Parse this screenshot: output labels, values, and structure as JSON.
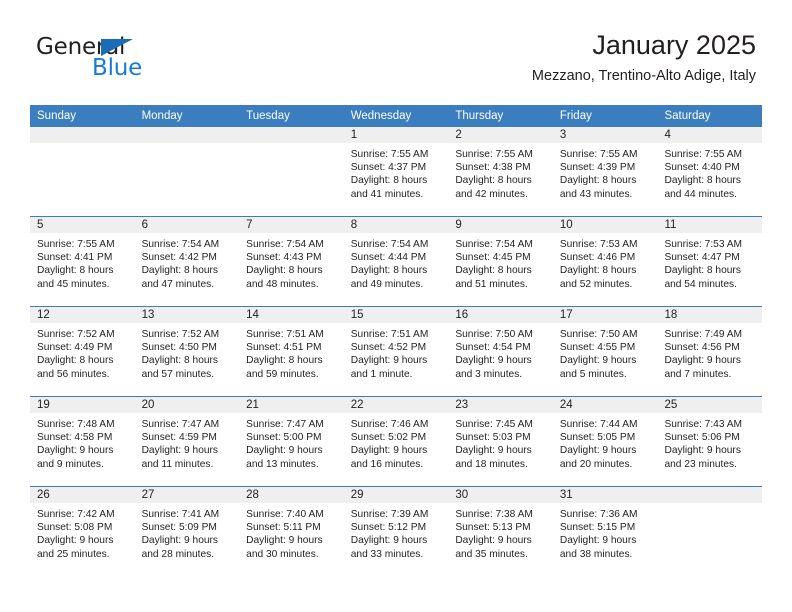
{
  "brand": {
    "name_part1": "General",
    "name_part2": "Blue",
    "accent_color": "#1a7bd4",
    "header_color": "#3a7ebf"
  },
  "header": {
    "title": "January 2025",
    "subtitle": "Mezzano, Trentino-Alto Adige, Italy"
  },
  "weekdays": [
    "Sunday",
    "Monday",
    "Tuesday",
    "Wednesday",
    "Thursday",
    "Friday",
    "Saturday"
  ],
  "weeks": [
    [
      {
        "day": "",
        "sunrise": "",
        "sunset": "",
        "daylight_line1": "",
        "daylight_line2": ""
      },
      {
        "day": "",
        "sunrise": "",
        "sunset": "",
        "daylight_line1": "",
        "daylight_line2": ""
      },
      {
        "day": "",
        "sunrise": "",
        "sunset": "",
        "daylight_line1": "",
        "daylight_line2": ""
      },
      {
        "day": "1",
        "sunrise": "Sunrise: 7:55 AM",
        "sunset": "Sunset: 4:37 PM",
        "daylight_line1": "Daylight: 8 hours",
        "daylight_line2": "and 41 minutes."
      },
      {
        "day": "2",
        "sunrise": "Sunrise: 7:55 AM",
        "sunset": "Sunset: 4:38 PM",
        "daylight_line1": "Daylight: 8 hours",
        "daylight_line2": "and 42 minutes."
      },
      {
        "day": "3",
        "sunrise": "Sunrise: 7:55 AM",
        "sunset": "Sunset: 4:39 PM",
        "daylight_line1": "Daylight: 8 hours",
        "daylight_line2": "and 43 minutes."
      },
      {
        "day": "4",
        "sunrise": "Sunrise: 7:55 AM",
        "sunset": "Sunset: 4:40 PM",
        "daylight_line1": "Daylight: 8 hours",
        "daylight_line2": "and 44 minutes."
      }
    ],
    [
      {
        "day": "5",
        "sunrise": "Sunrise: 7:55 AM",
        "sunset": "Sunset: 4:41 PM",
        "daylight_line1": "Daylight: 8 hours",
        "daylight_line2": "and 45 minutes."
      },
      {
        "day": "6",
        "sunrise": "Sunrise: 7:54 AM",
        "sunset": "Sunset: 4:42 PM",
        "daylight_line1": "Daylight: 8 hours",
        "daylight_line2": "and 47 minutes."
      },
      {
        "day": "7",
        "sunrise": "Sunrise: 7:54 AM",
        "sunset": "Sunset: 4:43 PM",
        "daylight_line1": "Daylight: 8 hours",
        "daylight_line2": "and 48 minutes."
      },
      {
        "day": "8",
        "sunrise": "Sunrise: 7:54 AM",
        "sunset": "Sunset: 4:44 PM",
        "daylight_line1": "Daylight: 8 hours",
        "daylight_line2": "and 49 minutes."
      },
      {
        "day": "9",
        "sunrise": "Sunrise: 7:54 AM",
        "sunset": "Sunset: 4:45 PM",
        "daylight_line1": "Daylight: 8 hours",
        "daylight_line2": "and 51 minutes."
      },
      {
        "day": "10",
        "sunrise": "Sunrise: 7:53 AM",
        "sunset": "Sunset: 4:46 PM",
        "daylight_line1": "Daylight: 8 hours",
        "daylight_line2": "and 52 minutes."
      },
      {
        "day": "11",
        "sunrise": "Sunrise: 7:53 AM",
        "sunset": "Sunset: 4:47 PM",
        "daylight_line1": "Daylight: 8 hours",
        "daylight_line2": "and 54 minutes."
      }
    ],
    [
      {
        "day": "12",
        "sunrise": "Sunrise: 7:52 AM",
        "sunset": "Sunset: 4:49 PM",
        "daylight_line1": "Daylight: 8 hours",
        "daylight_line2": "and 56 minutes."
      },
      {
        "day": "13",
        "sunrise": "Sunrise: 7:52 AM",
        "sunset": "Sunset: 4:50 PM",
        "daylight_line1": "Daylight: 8 hours",
        "daylight_line2": "and 57 minutes."
      },
      {
        "day": "14",
        "sunrise": "Sunrise: 7:51 AM",
        "sunset": "Sunset: 4:51 PM",
        "daylight_line1": "Daylight: 8 hours",
        "daylight_line2": "and 59 minutes."
      },
      {
        "day": "15",
        "sunrise": "Sunrise: 7:51 AM",
        "sunset": "Sunset: 4:52 PM",
        "daylight_line1": "Daylight: 9 hours",
        "daylight_line2": "and 1 minute."
      },
      {
        "day": "16",
        "sunrise": "Sunrise: 7:50 AM",
        "sunset": "Sunset: 4:54 PM",
        "daylight_line1": "Daylight: 9 hours",
        "daylight_line2": "and 3 minutes."
      },
      {
        "day": "17",
        "sunrise": "Sunrise: 7:50 AM",
        "sunset": "Sunset: 4:55 PM",
        "daylight_line1": "Daylight: 9 hours",
        "daylight_line2": "and 5 minutes."
      },
      {
        "day": "18",
        "sunrise": "Sunrise: 7:49 AM",
        "sunset": "Sunset: 4:56 PM",
        "daylight_line1": "Daylight: 9 hours",
        "daylight_line2": "and 7 minutes."
      }
    ],
    [
      {
        "day": "19",
        "sunrise": "Sunrise: 7:48 AM",
        "sunset": "Sunset: 4:58 PM",
        "daylight_line1": "Daylight: 9 hours",
        "daylight_line2": "and 9 minutes."
      },
      {
        "day": "20",
        "sunrise": "Sunrise: 7:47 AM",
        "sunset": "Sunset: 4:59 PM",
        "daylight_line1": "Daylight: 9 hours",
        "daylight_line2": "and 11 minutes."
      },
      {
        "day": "21",
        "sunrise": "Sunrise: 7:47 AM",
        "sunset": "Sunset: 5:00 PM",
        "daylight_line1": "Daylight: 9 hours",
        "daylight_line2": "and 13 minutes."
      },
      {
        "day": "22",
        "sunrise": "Sunrise: 7:46 AM",
        "sunset": "Sunset: 5:02 PM",
        "daylight_line1": "Daylight: 9 hours",
        "daylight_line2": "and 16 minutes."
      },
      {
        "day": "23",
        "sunrise": "Sunrise: 7:45 AM",
        "sunset": "Sunset: 5:03 PM",
        "daylight_line1": "Daylight: 9 hours",
        "daylight_line2": "and 18 minutes."
      },
      {
        "day": "24",
        "sunrise": "Sunrise: 7:44 AM",
        "sunset": "Sunset: 5:05 PM",
        "daylight_line1": "Daylight: 9 hours",
        "daylight_line2": "and 20 minutes."
      },
      {
        "day": "25",
        "sunrise": "Sunrise: 7:43 AM",
        "sunset": "Sunset: 5:06 PM",
        "daylight_line1": "Daylight: 9 hours",
        "daylight_line2": "and 23 minutes."
      }
    ],
    [
      {
        "day": "26",
        "sunrise": "Sunrise: 7:42 AM",
        "sunset": "Sunset: 5:08 PM",
        "daylight_line1": "Daylight: 9 hours",
        "daylight_line2": "and 25 minutes."
      },
      {
        "day": "27",
        "sunrise": "Sunrise: 7:41 AM",
        "sunset": "Sunset: 5:09 PM",
        "daylight_line1": "Daylight: 9 hours",
        "daylight_line2": "and 28 minutes."
      },
      {
        "day": "28",
        "sunrise": "Sunrise: 7:40 AM",
        "sunset": "Sunset: 5:11 PM",
        "daylight_line1": "Daylight: 9 hours",
        "daylight_line2": "and 30 minutes."
      },
      {
        "day": "29",
        "sunrise": "Sunrise: 7:39 AM",
        "sunset": "Sunset: 5:12 PM",
        "daylight_line1": "Daylight: 9 hours",
        "daylight_line2": "and 33 minutes."
      },
      {
        "day": "30",
        "sunrise": "Sunrise: 7:38 AM",
        "sunset": "Sunset: 5:13 PM",
        "daylight_line1": "Daylight: 9 hours",
        "daylight_line2": "and 35 minutes."
      },
      {
        "day": "31",
        "sunrise": "Sunrise: 7:36 AM",
        "sunset": "Sunset: 5:15 PM",
        "daylight_line1": "Daylight: 9 hours",
        "daylight_line2": "and 38 minutes."
      },
      {
        "day": "",
        "sunrise": "",
        "sunset": "",
        "daylight_line1": "",
        "daylight_line2": ""
      }
    ]
  ]
}
